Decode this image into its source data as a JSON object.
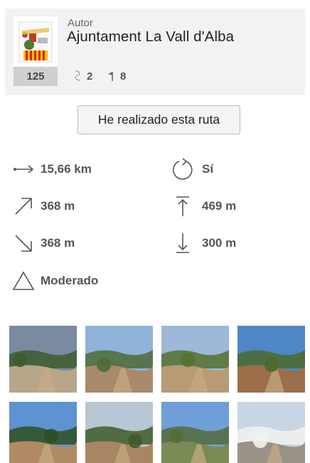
{
  "author": {
    "label": "Autor",
    "name": "Ajuntament La Vall d'Alba",
    "routes_count": "125",
    "stats": [
      {
        "icon": "route-icon",
        "value": "2"
      },
      {
        "icon": "waypoint-flag-icon",
        "value": "8"
      }
    ]
  },
  "done_button_label": "He realizado esta ruta",
  "route_stats": {
    "distance": "15,66 km",
    "loop": "Sí",
    "elevation_gain": "368 m",
    "max_altitude": "469 m",
    "elevation_loss": "368 m",
    "min_altitude": "300 m",
    "difficulty": "Moderado"
  },
  "photos": [
    {
      "name": "photo-1",
      "sky": "#7a8aa0",
      "ground": "#b8a58a",
      "accent": "#3d5a2e"
    },
    {
      "name": "photo-2",
      "sky": "#8fb3d9",
      "ground": "#a88a6a",
      "accent": "#4e6b34"
    },
    {
      "name": "photo-3",
      "sky": "#9db8d8",
      "ground": "#b89a74",
      "accent": "#53712f"
    },
    {
      "name": "photo-4",
      "sky": "#4f86c6",
      "ground": "#9c6e4a",
      "accent": "#4a6a2c"
    },
    {
      "name": "photo-5",
      "sky": "#5d93d0",
      "ground": "#b08a64",
      "accent": "#2f4f25"
    },
    {
      "name": "photo-6",
      "sky": "#b9c7d4",
      "ground": "#a98563",
      "accent": "#3e5a2a"
    },
    {
      "name": "photo-7",
      "sky": "#6f9fd8",
      "ground": "#7a8a55",
      "accent": "#556b3a"
    },
    {
      "name": "photo-8",
      "sky": "#c8d6e4",
      "ground": "#9a9188",
      "accent": "#f2f2f0"
    }
  ]
}
